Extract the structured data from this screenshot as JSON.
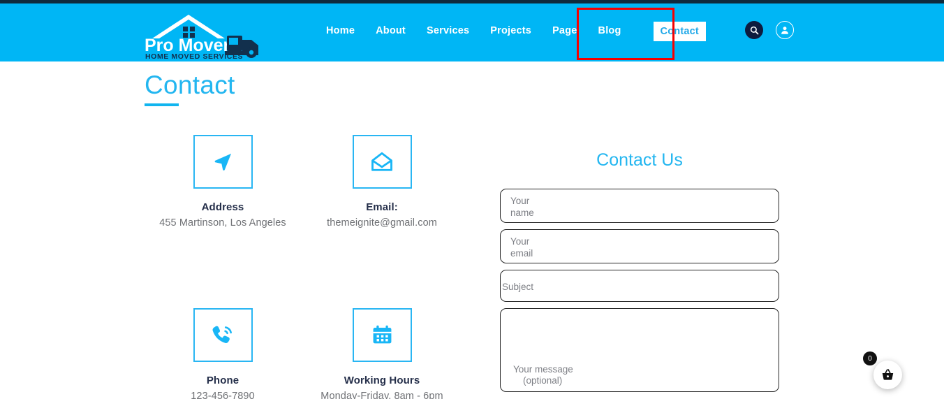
{
  "colors": {
    "header_bg": "#00b6f5",
    "top_strip": "#0f2b3d",
    "accent_blue": "#23b6f0",
    "icon_border": "#29b6f3",
    "label_dark": "#252f4a",
    "value_gray": "#6f7175",
    "annotation_red": "#f50000",
    "search_circle": "#0d1b3e"
  },
  "logo": {
    "name": "Pro Movers",
    "tagline": "HOME MOVED SERVICES"
  },
  "nav": {
    "items": [
      {
        "label": "Home",
        "active": false
      },
      {
        "label": "About",
        "active": false
      },
      {
        "label": "Services",
        "active": false
      },
      {
        "label": "Projects",
        "active": false
      },
      {
        "label": "Page",
        "active": false
      },
      {
        "label": "Blog",
        "active": false
      },
      {
        "label": "Contact",
        "active": true
      }
    ]
  },
  "header_icons": {
    "search": "search-icon",
    "account": "user-account-icon"
  },
  "page": {
    "title": "Contact"
  },
  "contact_info": [
    {
      "icon": "navigation-arrow-icon",
      "label": "Address",
      "value": "455 Martinson, Los Angeles"
    },
    {
      "icon": "open-envelope-icon",
      "label": "Email:",
      "value": "themeignite@gmail.com"
    },
    {
      "icon": "ringing-phone-icon",
      "label": "Phone",
      "value": "123-456-7890"
    },
    {
      "icon": "calendar-icon",
      "label": "Working Hours",
      "value": "Monday-Friday, 8am - 6pm"
    }
  ],
  "form": {
    "title": "Contact Us",
    "fields": [
      {
        "name": "name",
        "placeholder_line1": "Your",
        "placeholder_line2": "name",
        "value": ""
      },
      {
        "name": "email",
        "placeholder_line1": "Your",
        "placeholder_line2": "email",
        "value": ""
      },
      {
        "name": "subject",
        "placeholder_line1": "Subject",
        "placeholder_line2": "",
        "value": ""
      },
      {
        "name": "message",
        "placeholder_line1": "Your message",
        "placeholder_line2": "(optional)",
        "value": ""
      }
    ]
  },
  "cart": {
    "count": "0",
    "icon": "shopping-basket-icon"
  }
}
